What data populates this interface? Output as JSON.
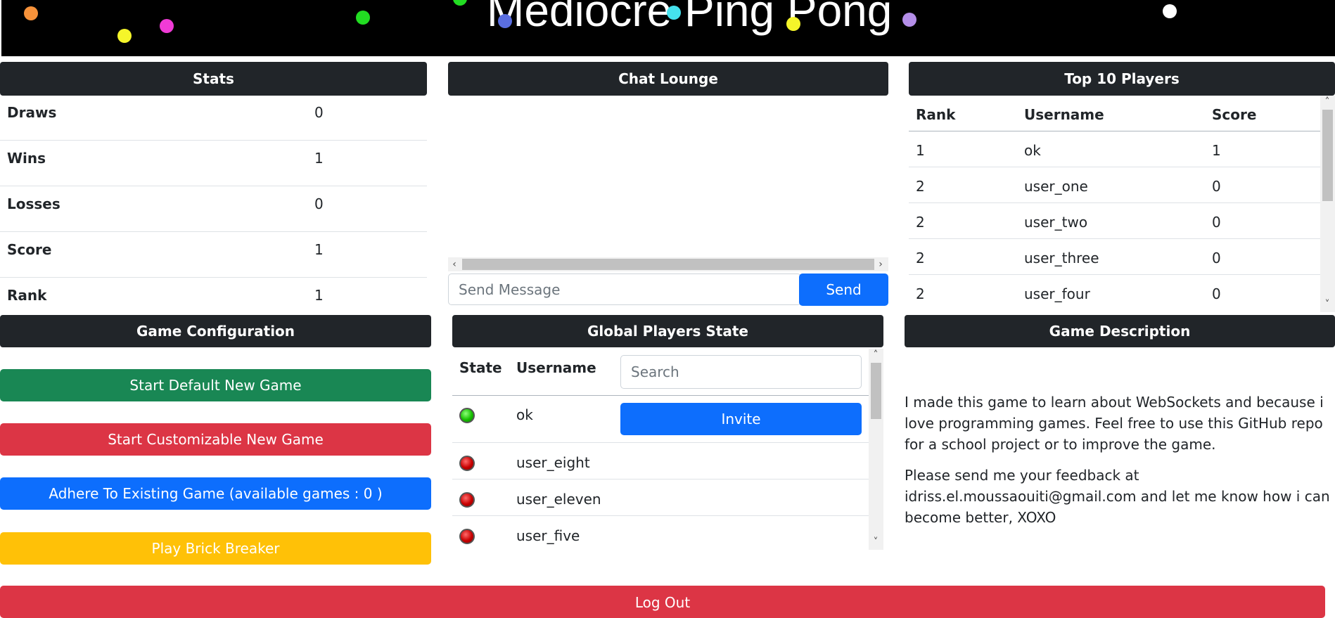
{
  "banner": {
    "title": "Mediocre Ping Pong"
  },
  "stats": {
    "header": "Stats",
    "rows": [
      {
        "label": "Draws",
        "value": "0"
      },
      {
        "label": "Wins",
        "value": "1"
      },
      {
        "label": "Losses",
        "value": "0"
      },
      {
        "label": "Score",
        "value": "1"
      },
      {
        "label": "Rank",
        "value": "1"
      }
    ]
  },
  "chat": {
    "header": "Chat Lounge",
    "input_placeholder": "Send Message",
    "send_label": "Send"
  },
  "top_players": {
    "header": "Top 10 Players",
    "columns": [
      "Rank",
      "Username",
      "Score"
    ],
    "rows": [
      [
        "1",
        "ok",
        "1"
      ],
      [
        "2",
        "user_one",
        "0"
      ],
      [
        "2",
        "user_two",
        "0"
      ],
      [
        "2",
        "user_three",
        "0"
      ],
      [
        "2",
        "user_four",
        "0"
      ]
    ]
  },
  "game_config": {
    "header": "Game Configuration",
    "buttons": [
      {
        "label": "Start Default New Game",
        "color": "#198754"
      },
      {
        "label": "Start Customizable New Game",
        "color": "#dc3545"
      },
      {
        "label": "Adhere To Existing Game (available games : 0 )",
        "color": "#0d6efd"
      },
      {
        "label": "Play Brick Breaker",
        "color": "#ffc107"
      }
    ]
  },
  "global_players": {
    "header": "Global Players State",
    "columns": [
      "State",
      "Username"
    ],
    "search_placeholder": "Search",
    "invite_label": "Invite",
    "rows": [
      {
        "username": "ok",
        "online": true
      },
      {
        "username": "user_eight",
        "online": false
      },
      {
        "username": "user_eleven",
        "online": false
      },
      {
        "username": "user_five",
        "online": false
      }
    ]
  },
  "game_description": {
    "header": "Game Description",
    "paragraphs": [
      "I made this game to learn about WebSockets and because i love programming games. Feel free to use this GitHub repo for a school project or to improve the game.",
      "Please send me your feedback at idriss.el.moussaouiti@gmail.com and let me know how i can become better, XOXO"
    ]
  },
  "logout_label": "Log Out",
  "colors": {
    "dark": "#212529",
    "primary": "#0d6efd",
    "success": "#198754",
    "danger": "#dc3545",
    "warning": "#ffc107"
  }
}
